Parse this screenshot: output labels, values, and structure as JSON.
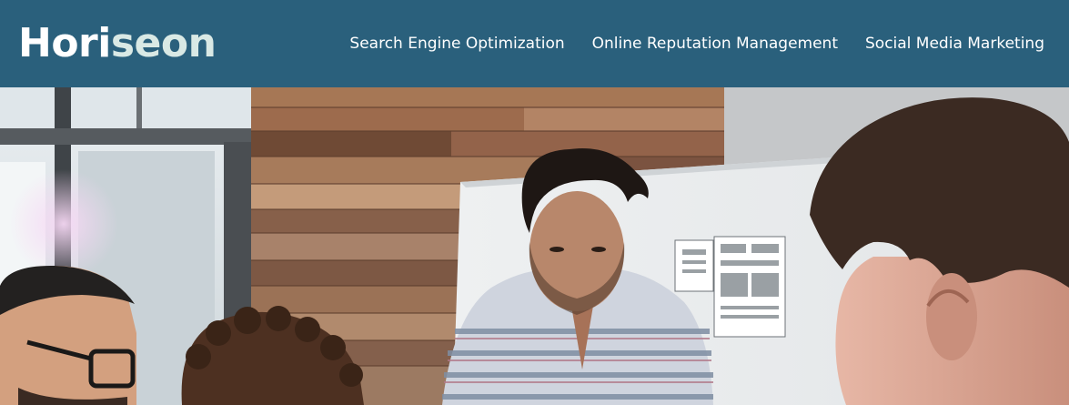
{
  "header": {
    "logo": {
      "part1": "Hori",
      "part2": "seon"
    },
    "nav": [
      {
        "label": "Search Engine Optimization"
      },
      {
        "label": "Online Reputation Management"
      },
      {
        "label": "Social Media Marketing"
      }
    ]
  },
  "colors": {
    "header_bg": "#2a607c",
    "logo_accent": "#d9e9e5",
    "text": "#ffffff"
  },
  "hero": {
    "image_description_icon": "team-meeting-photo"
  }
}
